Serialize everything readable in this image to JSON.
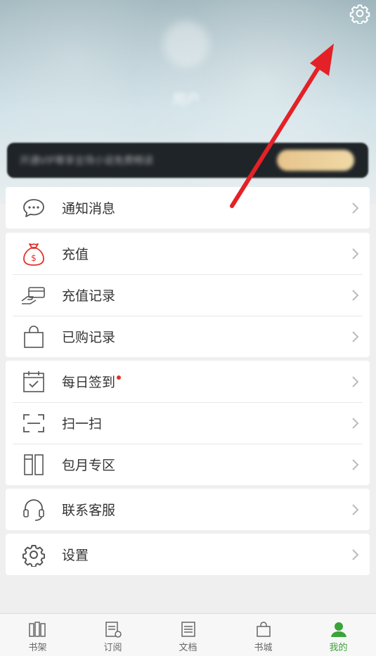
{
  "header": {
    "username": "用户",
    "vip_banner_text": "开通VIP尊享全场小说免费畅读"
  },
  "menu": {
    "group1": [
      {
        "label": "通知消息",
        "icon": "message-icon"
      }
    ],
    "group2": [
      {
        "label": "充值",
        "icon": "money-bag-icon"
      },
      {
        "label": "充值记录",
        "icon": "card-hand-icon"
      },
      {
        "label": "已购记录",
        "icon": "shopping-bag-icon"
      }
    ],
    "group3": [
      {
        "label": "每日签到",
        "icon": "calendar-check-icon"
      },
      {
        "label": "扫一扫",
        "icon": "scan-icon"
      },
      {
        "label": "包月专区",
        "icon": "books-icon"
      }
    ],
    "group4": [
      {
        "label": "联系客服",
        "icon": "headset-icon"
      }
    ],
    "group5": [
      {
        "label": "设置",
        "icon": "gear-icon"
      }
    ]
  },
  "bottom_nav": [
    {
      "label": "书架",
      "active": false
    },
    {
      "label": "订阅",
      "active": false
    },
    {
      "label": "文档",
      "active": false
    },
    {
      "label": "书城",
      "active": false
    },
    {
      "label": "我的",
      "active": true
    }
  ],
  "colors": {
    "accent": "#3aa33a",
    "arrow": "#e42126",
    "badge": "#e4312c"
  }
}
